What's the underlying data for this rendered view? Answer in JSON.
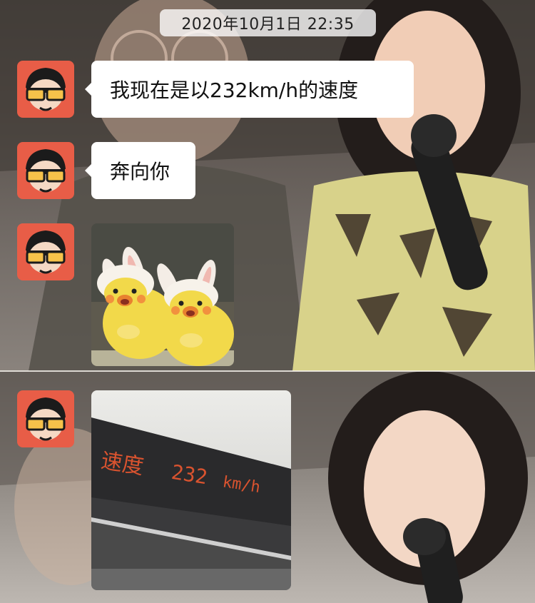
{
  "chat": {
    "timestamp": "2020年10月1日 22:35",
    "messages": [
      {
        "type": "text",
        "text": "我现在是以232km/h的速度",
        "sender": "contact"
      },
      {
        "type": "text",
        "text": "奔向你",
        "sender": "contact"
      },
      {
        "type": "image",
        "image": "two yellow duck plushies wearing bunny ear hats",
        "sender": "contact"
      },
      {
        "type": "image",
        "image": "train speed display",
        "sender": "contact",
        "display_text": {
          "label": "速度",
          "value": "232",
          "unit": "km/h"
        }
      }
    ]
  },
  "colors": {
    "bubble_bg": "#ffffff",
    "timestamp_bg": "#ffffffc8",
    "avatar_bg": "#e85d47",
    "led_text": "#d9532f",
    "duck_yellow": "#f2d94a"
  },
  "icons": {
    "avatar": "cartoon-boy-with-glasses-avatar"
  }
}
